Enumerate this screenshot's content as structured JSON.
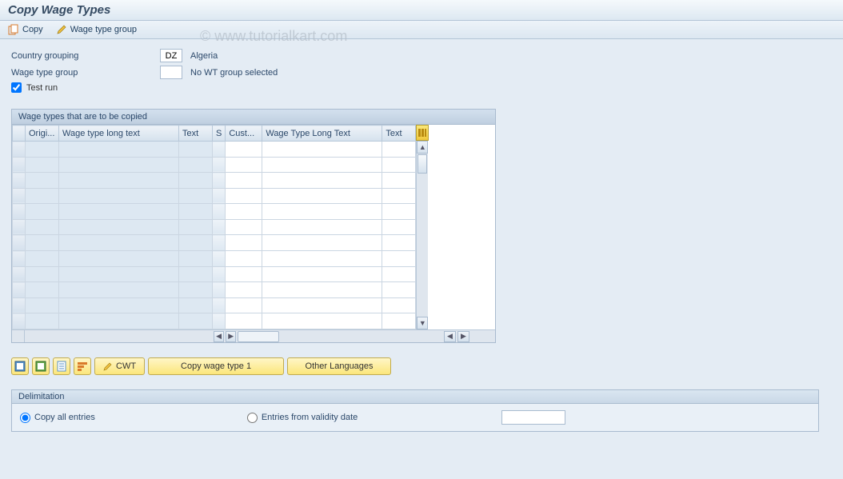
{
  "title": "Copy Wage Types",
  "toolbar": {
    "copy_label": "Copy",
    "wage_group_label": "Wage type group"
  },
  "watermark": "© www.tutorialkart.com",
  "form": {
    "country_grouping_label": "Country grouping",
    "country_grouping_value": "DZ",
    "country_grouping_text": "Algeria",
    "wage_type_group_label": "Wage type group",
    "wage_type_group_value": "",
    "wage_type_group_text": "No WT group selected",
    "test_run_label": "Test run",
    "test_run_checked": true
  },
  "table": {
    "title": "Wage types that are to be copied",
    "columns": {
      "origi": "Origi...",
      "wt_long_text": "Wage type long text",
      "text": "Text",
      "s": "S",
      "cust": "Cust...",
      "wt_long_text2": "Wage Type Long Text",
      "text2": "Text"
    },
    "rows": 12
  },
  "buttons": {
    "cwt": "CWT",
    "copy_wt1": "Copy wage type 1",
    "other_lang": "Other Languages"
  },
  "delimitation": {
    "title": "Delimitation",
    "copy_all": "Copy all entries",
    "entries_from": "Entries from validity date"
  }
}
